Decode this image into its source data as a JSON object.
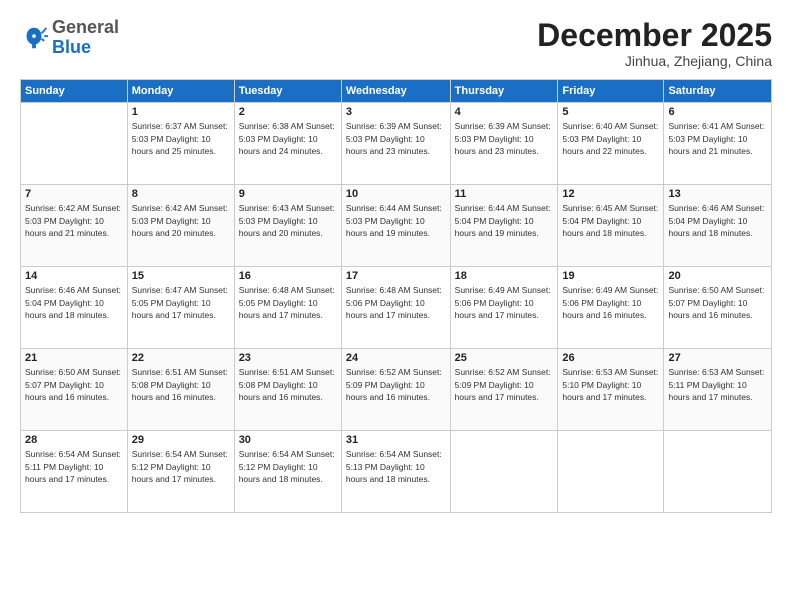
{
  "header": {
    "logo_general": "General",
    "logo_blue": "Blue",
    "month": "December 2025",
    "location": "Jinhua, Zhejiang, China"
  },
  "weekdays": [
    "Sunday",
    "Monday",
    "Tuesday",
    "Wednesday",
    "Thursday",
    "Friday",
    "Saturday"
  ],
  "weeks": [
    [
      {
        "day": "",
        "info": ""
      },
      {
        "day": "1",
        "info": "Sunrise: 6:37 AM\nSunset: 5:03 PM\nDaylight: 10 hours\nand 25 minutes."
      },
      {
        "day": "2",
        "info": "Sunrise: 6:38 AM\nSunset: 5:03 PM\nDaylight: 10 hours\nand 24 minutes."
      },
      {
        "day": "3",
        "info": "Sunrise: 6:39 AM\nSunset: 5:03 PM\nDaylight: 10 hours\nand 23 minutes."
      },
      {
        "day": "4",
        "info": "Sunrise: 6:39 AM\nSunset: 5:03 PM\nDaylight: 10 hours\nand 23 minutes."
      },
      {
        "day": "5",
        "info": "Sunrise: 6:40 AM\nSunset: 5:03 PM\nDaylight: 10 hours\nand 22 minutes."
      },
      {
        "day": "6",
        "info": "Sunrise: 6:41 AM\nSunset: 5:03 PM\nDaylight: 10 hours\nand 21 minutes."
      }
    ],
    [
      {
        "day": "7",
        "info": "Sunrise: 6:42 AM\nSunset: 5:03 PM\nDaylight: 10 hours\nand 21 minutes."
      },
      {
        "day": "8",
        "info": "Sunrise: 6:42 AM\nSunset: 5:03 PM\nDaylight: 10 hours\nand 20 minutes."
      },
      {
        "day": "9",
        "info": "Sunrise: 6:43 AM\nSunset: 5:03 PM\nDaylight: 10 hours\nand 20 minutes."
      },
      {
        "day": "10",
        "info": "Sunrise: 6:44 AM\nSunset: 5:03 PM\nDaylight: 10 hours\nand 19 minutes."
      },
      {
        "day": "11",
        "info": "Sunrise: 6:44 AM\nSunset: 5:04 PM\nDaylight: 10 hours\nand 19 minutes."
      },
      {
        "day": "12",
        "info": "Sunrise: 6:45 AM\nSunset: 5:04 PM\nDaylight: 10 hours\nand 18 minutes."
      },
      {
        "day": "13",
        "info": "Sunrise: 6:46 AM\nSunset: 5:04 PM\nDaylight: 10 hours\nand 18 minutes."
      }
    ],
    [
      {
        "day": "14",
        "info": "Sunrise: 6:46 AM\nSunset: 5:04 PM\nDaylight: 10 hours\nand 18 minutes."
      },
      {
        "day": "15",
        "info": "Sunrise: 6:47 AM\nSunset: 5:05 PM\nDaylight: 10 hours\nand 17 minutes."
      },
      {
        "day": "16",
        "info": "Sunrise: 6:48 AM\nSunset: 5:05 PM\nDaylight: 10 hours\nand 17 minutes."
      },
      {
        "day": "17",
        "info": "Sunrise: 6:48 AM\nSunset: 5:06 PM\nDaylight: 10 hours\nand 17 minutes."
      },
      {
        "day": "18",
        "info": "Sunrise: 6:49 AM\nSunset: 5:06 PM\nDaylight: 10 hours\nand 17 minutes."
      },
      {
        "day": "19",
        "info": "Sunrise: 6:49 AM\nSunset: 5:06 PM\nDaylight: 10 hours\nand 16 minutes."
      },
      {
        "day": "20",
        "info": "Sunrise: 6:50 AM\nSunset: 5:07 PM\nDaylight: 10 hours\nand 16 minutes."
      }
    ],
    [
      {
        "day": "21",
        "info": "Sunrise: 6:50 AM\nSunset: 5:07 PM\nDaylight: 10 hours\nand 16 minutes."
      },
      {
        "day": "22",
        "info": "Sunrise: 6:51 AM\nSunset: 5:08 PM\nDaylight: 10 hours\nand 16 minutes."
      },
      {
        "day": "23",
        "info": "Sunrise: 6:51 AM\nSunset: 5:08 PM\nDaylight: 10 hours\nand 16 minutes."
      },
      {
        "day": "24",
        "info": "Sunrise: 6:52 AM\nSunset: 5:09 PM\nDaylight: 10 hours\nand 16 minutes."
      },
      {
        "day": "25",
        "info": "Sunrise: 6:52 AM\nSunset: 5:09 PM\nDaylight: 10 hours\nand 17 minutes."
      },
      {
        "day": "26",
        "info": "Sunrise: 6:53 AM\nSunset: 5:10 PM\nDaylight: 10 hours\nand 17 minutes."
      },
      {
        "day": "27",
        "info": "Sunrise: 6:53 AM\nSunset: 5:11 PM\nDaylight: 10 hours\nand 17 minutes."
      }
    ],
    [
      {
        "day": "28",
        "info": "Sunrise: 6:54 AM\nSunset: 5:11 PM\nDaylight: 10 hours\nand 17 minutes."
      },
      {
        "day": "29",
        "info": "Sunrise: 6:54 AM\nSunset: 5:12 PM\nDaylight: 10 hours\nand 17 minutes."
      },
      {
        "day": "30",
        "info": "Sunrise: 6:54 AM\nSunset: 5:12 PM\nDaylight: 10 hours\nand 18 minutes."
      },
      {
        "day": "31",
        "info": "Sunrise: 6:54 AM\nSunset: 5:13 PM\nDaylight: 10 hours\nand 18 minutes."
      },
      {
        "day": "",
        "info": ""
      },
      {
        "day": "",
        "info": ""
      },
      {
        "day": "",
        "info": ""
      }
    ]
  ]
}
